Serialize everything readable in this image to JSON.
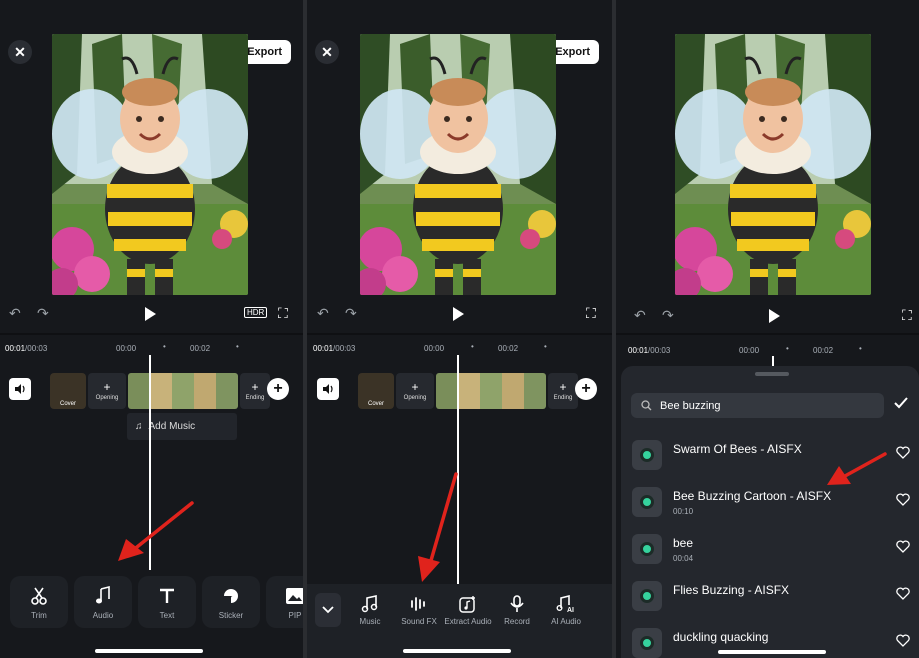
{
  "panel1": {
    "export_label": "Export",
    "timecode_current": "00:01",
    "timecode_total": "/00:03",
    "tick_a": "00:00",
    "tick_b": "00:02",
    "cover_label": "Cover",
    "opening_label": "Opening",
    "ending_label": "Ending",
    "add_music_label": "Add Music",
    "tools": [
      {
        "label": "Trim",
        "icon": "scissors-icon"
      },
      {
        "label": "Audio",
        "icon": "music-note-icon"
      },
      {
        "label": "Text",
        "icon": "text-icon"
      },
      {
        "label": "Sticker",
        "icon": "sticker-icon"
      },
      {
        "label": "PIP",
        "icon": "pip-icon"
      }
    ]
  },
  "panel2": {
    "export_label": "Export",
    "timecode_current": "00:01",
    "timecode_total": "/00:03",
    "tick_a": "00:00",
    "tick_b": "00:02",
    "cover_label": "Cover",
    "opening_label": "Opening",
    "ending_label": "Ending",
    "audio_tools": [
      {
        "label": "Music",
        "icon": "music-icon"
      },
      {
        "label": "Sound FX",
        "icon": "waveform-icon"
      },
      {
        "label": "Extract Audio",
        "icon": "extract-audio-icon"
      },
      {
        "label": "Record",
        "icon": "microphone-icon"
      },
      {
        "label": "AI Audio",
        "icon": "ai-audio-icon"
      }
    ]
  },
  "panel3": {
    "timecode_current": "00:01",
    "timecode_total": "/00:03",
    "tick_a": "00:00",
    "tick_b": "00:02",
    "search_value": "Bee buzzing",
    "tracks": [
      {
        "name": "Swarm Of Bees - AISFX",
        "duration": ""
      },
      {
        "name": "Bee Buzzing Cartoon - AISFX",
        "duration": "00:10"
      },
      {
        "name": "bee",
        "duration": "00:04"
      },
      {
        "name": "Flies Buzzing - AISFX",
        "duration": ""
      },
      {
        "name": "duckling quacking",
        "duration": ""
      }
    ]
  },
  "colors": {
    "background": "#16181c",
    "accent_green": "#35d39d",
    "annotation_red": "#e0231c"
  }
}
